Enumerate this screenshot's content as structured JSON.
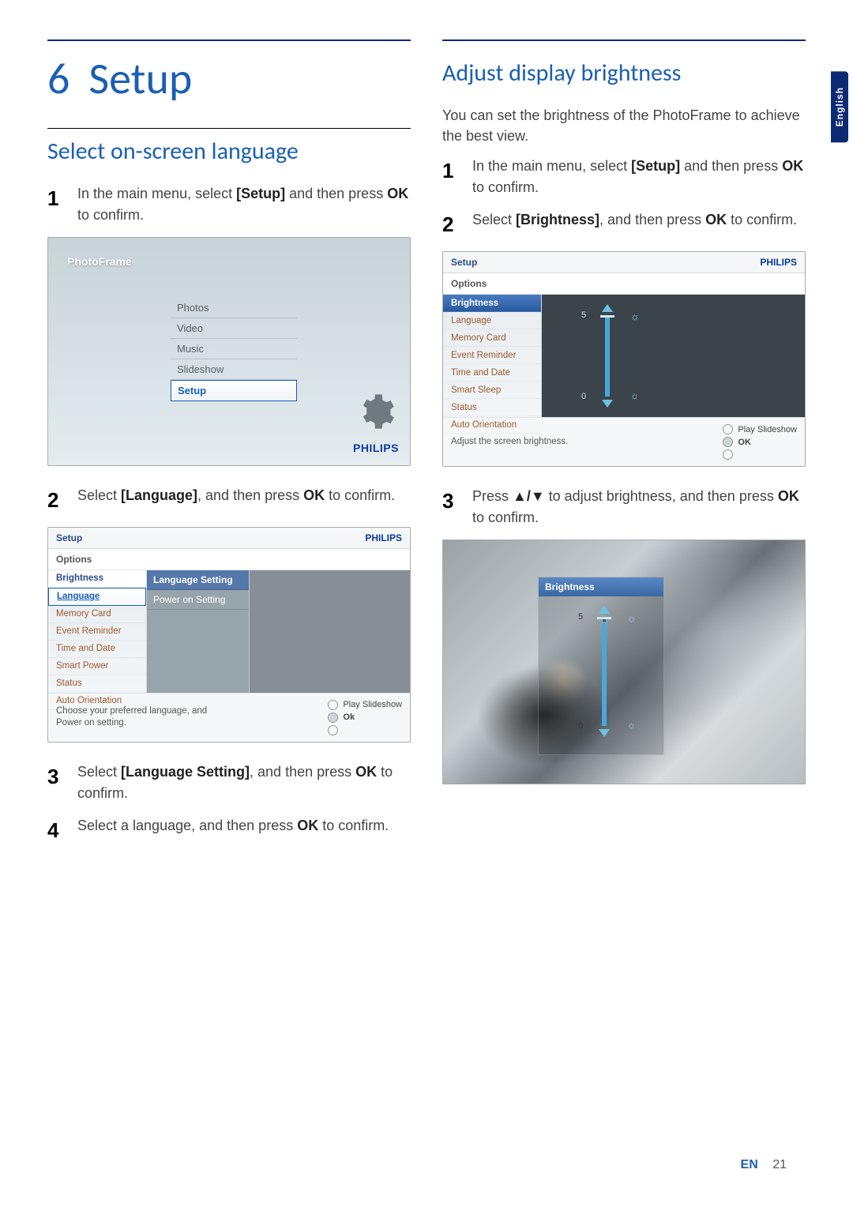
{
  "side_tab": "English",
  "chapter": {
    "number": "6",
    "title": "Setup"
  },
  "left": {
    "section_title": "Select on-screen language",
    "steps": [
      {
        "n": "1",
        "text_pre": "In the main menu, select ",
        "bold1": "[Setup]",
        "text_mid": " and then press ",
        "bold2": "OK",
        "text_post": " to confirm."
      },
      {
        "n": "2",
        "text_pre": "Select ",
        "bold1": "[Language]",
        "text_mid": ", and then press ",
        "bold2": "OK",
        "text_post": " to confirm."
      },
      {
        "n": "3",
        "text_pre": "Select ",
        "bold1": "[Language Setting]",
        "text_mid": ", and then press ",
        "bold2": "OK",
        "text_post": " to confirm."
      },
      {
        "n": "4",
        "text_pre": "Select a language, and then press ",
        "bold1": "OK",
        "text_mid": "",
        "bold2": "",
        "text_post": " to confirm."
      }
    ],
    "shot1": {
      "title": "PhotoFrame",
      "menu": [
        "Photos",
        "Video",
        "Music",
        "Slideshow",
        "Setup"
      ],
      "selected": "Setup",
      "brand": "PHILIPS"
    },
    "shot2": {
      "header": "Setup",
      "brand": "PHILIPS",
      "options_label": "Options",
      "side": [
        "Brightness",
        "Language",
        "Memory Card",
        "Event Reminder",
        "Time and Date",
        "Smart Power",
        "Status",
        "Auto Orientation"
      ],
      "side_highlight": "Brightness",
      "side_selected": "Language",
      "submenu": [
        "Language Setting",
        "Power on Setting"
      ],
      "submenu_selected": "Language Setting",
      "footer_hint": "Choose your preferred language, and Power on setting.",
      "footer_play": "Play Slideshow",
      "footer_ok": "Ok"
    }
  },
  "right": {
    "section_title": "Adjust display brightness",
    "intro": "You can set the brightness of the PhotoFrame to achieve the best view.",
    "steps": [
      {
        "n": "1",
        "text_pre": "In the main menu, select ",
        "bold1": "[Setup]",
        "text_mid": " and then press ",
        "bold2": "OK",
        "text_post": " to confirm."
      },
      {
        "n": "2",
        "text_pre": "Select ",
        "bold1": "[Brightness]",
        "text_mid": ", and then press ",
        "bold2": "OK",
        "text_post": " to confirm."
      },
      {
        "n": "3",
        "text_pre": "Press ",
        "bold1": "▲/▼",
        "text_mid": " to adjust brightness, and then press ",
        "bold2": "OK",
        "text_post": " to confirm."
      }
    ],
    "shot3": {
      "header": "Setup",
      "brand": "PHILIPS",
      "options_label": "Options",
      "side": [
        "Brightness",
        "Language",
        "Memory Card",
        "Event Reminder",
        "Time and Date",
        "Smart Sleep",
        "Status",
        "Auto Orientation"
      ],
      "side_selected": "Brightness",
      "slider": {
        "max_label": "5",
        "min_label": "0",
        "value": 5
      },
      "footer_hint": "Adjust the screen brightness.",
      "footer_play": "Play Slideshow",
      "footer_ok": "OK"
    },
    "shot4": {
      "overlay_title": "Brightness",
      "slider": {
        "max_label": "5",
        "min_label": "0",
        "value": 5
      }
    }
  },
  "footer": {
    "lang": "EN",
    "page": "21"
  }
}
